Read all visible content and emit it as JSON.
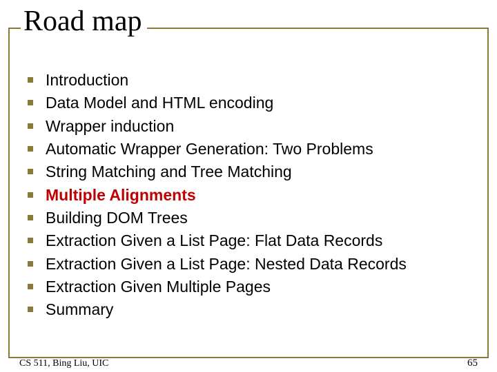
{
  "title": "Road map",
  "items": [
    {
      "text": "Introduction",
      "highlight": false
    },
    {
      "text": "Data Model and HTML encoding",
      "highlight": false
    },
    {
      "text": "Wrapper induction",
      "highlight": false
    },
    {
      "text": "Automatic Wrapper Generation: Two Problems",
      "highlight": false
    },
    {
      "text": "String Matching and Tree Matching",
      "highlight": false
    },
    {
      "text": "Multiple Alignments",
      "highlight": true
    },
    {
      "text": "Building DOM Trees",
      "highlight": false
    },
    {
      "text": "Extraction Given a List Page: Flat Data Records",
      "highlight": false
    },
    {
      "text": "Extraction Given a List Page: Nested Data Records",
      "highlight": false
    },
    {
      "text": "Extraction Given Multiple Pages",
      "highlight": false
    },
    {
      "text": "Summary",
      "highlight": false
    }
  ],
  "footer": {
    "left": "CS 511, Bing Liu, UIC",
    "page": "65"
  }
}
